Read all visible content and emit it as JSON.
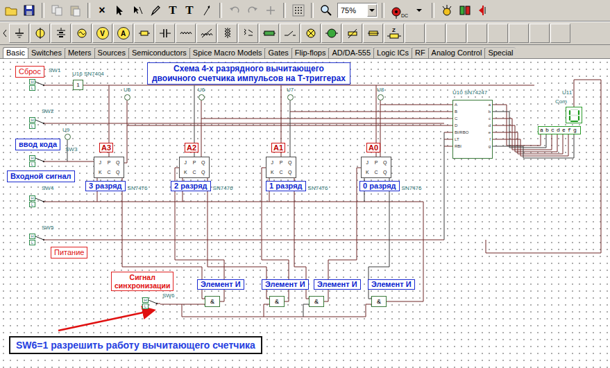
{
  "toolbar": {
    "close_glyph": "×",
    "text_glyph": "T",
    "text_edit_glyph": "T",
    "zoom": "75%",
    "probe_glyph": "DC"
  },
  "parts_bar": {
    "voltmeter_glyph": "V",
    "ammeter_glyph": "A",
    "zener_glyph": "Z"
  },
  "tabs": [
    {
      "label": "Basic",
      "selected": true
    },
    {
      "label": "Switches",
      "selected": false
    },
    {
      "label": "Meters",
      "selected": false
    },
    {
      "label": "Sources",
      "selected": false
    },
    {
      "label": "Semiconductors",
      "selected": false
    },
    {
      "label": "Spice Macro Models",
      "selected": false
    },
    {
      "label": "Gates",
      "selected": false
    },
    {
      "label": "Flip-flops",
      "selected": false
    },
    {
      "label": "AD/DA-555",
      "selected": false
    },
    {
      "label": "Logic ICs",
      "selected": false
    },
    {
      "label": "RF",
      "selected": false
    },
    {
      "label": "Analog Control",
      "selected": false
    },
    {
      "label": "Special",
      "selected": false
    }
  ],
  "schematic": {
    "title": [
      "Схема 4-х разрядного вычитающего",
      "двоичного счетчика импульсов на Т-триггерах"
    ],
    "switches": [
      {
        "name": "SW1",
        "high": "H",
        "low": "L",
        "position": "H"
      },
      {
        "name": "SW2",
        "high": "H",
        "low": "L",
        "position": "H"
      },
      {
        "name": "SW3",
        "high": "H",
        "low": "L",
        "position": "H"
      },
      {
        "name": "SW4",
        "high": "H",
        "low": "L",
        "position": "H"
      },
      {
        "name": "SW5",
        "high": "H",
        "low": "L",
        "position": "H"
      },
      {
        "name": "SW6",
        "high": "H",
        "low": "L",
        "position": "H"
      }
    ],
    "notes": [
      {
        "text": "Сброс",
        "kind": "red"
      },
      {
        "text": "ввод кода",
        "kind": "blue"
      },
      {
        "text": "Входной сигнал",
        "kind": "blue"
      },
      {
        "text": "Питание",
        "kind": "red"
      }
    ],
    "sync_note": [
      "Сигнал",
      "синхронизации"
    ],
    "inverter": {
      "name": "U16 SN7404",
      "symbol": "1"
    },
    "probes": [
      {
        "name": "U5",
        "lit": false
      },
      {
        "name": "U6",
        "lit": false
      },
      {
        "name": "U7",
        "lit": false
      },
      {
        "name": "U8",
        "lit": false
      },
      {
        "name": "U9",
        "lit": false
      }
    ],
    "flipflops": [
      {
        "name": "A3",
        "caption": "3 разряд",
        "part": "SN7476"
      },
      {
        "name": "A2",
        "caption": "2 разряд",
        "part": "SN7476"
      },
      {
        "name": "A1",
        "caption": "1 разряд",
        "part": "SN7476"
      },
      {
        "name": "A0",
        "caption": "0 разряд",
        "part": "SN7476"
      }
    ],
    "flipflop_pins": {
      "top": [
        "J",
        "P",
        "Q"
      ],
      "bottom": [
        "K",
        "C",
        "Q"
      ]
    },
    "gates": [
      {
        "caption": "Элемент И",
        "symbol": "&"
      },
      {
        "caption": "Элемент И",
        "symbol": "&"
      },
      {
        "caption": "Элемент И",
        "symbol": "&"
      },
      {
        "caption": "Элемент И",
        "symbol": "&"
      }
    ],
    "decoder": {
      "name": "U10 SN74247",
      "inputs": [
        "A",
        "B",
        "C",
        "D",
        "BI/RBO",
        "LT",
        "RBI"
      ],
      "outputs": [
        "a",
        "b",
        "c",
        "d",
        "e",
        "f",
        "g"
      ]
    },
    "display": {
      "name": "U11",
      "common": "Com",
      "pins": "abcdefg",
      "segments": [
        false,
        true,
        true,
        true,
        true,
        true,
        false
      ]
    },
    "banner": "SW6=1 разрешить работу вычитающего счетчика"
  }
}
